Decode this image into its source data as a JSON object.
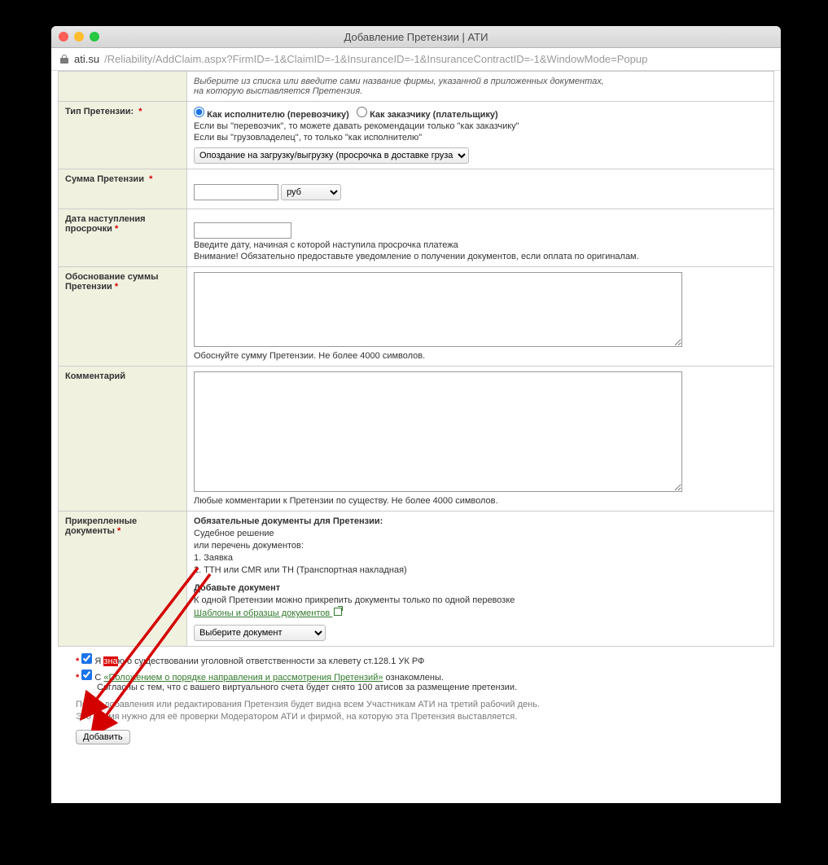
{
  "window": {
    "title": "Добавление Претензии | АТИ",
    "url_host": "ati.su",
    "url_path": "/Reliability/AddClaim.aspx?FirmID=-1&ClaimID=-1&InsuranceID=-1&InsuranceContractID=-1&WindowMode=Popup"
  },
  "rows": {
    "firm_hint1": "Выберите из списка или введите сами название фирмы, указанной в приложенных документах,",
    "firm_hint2": "на которую выставляется Претензия.",
    "type": {
      "label": "Тип Претензии:",
      "radio1": "Как исполнителю (перевозчику)",
      "radio2": "Как заказчику (плательщику)",
      "hint1": "Если вы \"перевозчик\", то можете давать рекомендации только \"как заказчику\"",
      "hint2": "Если вы \"грузовладелец\", то только \"как исполнителю\"",
      "select_value": "Опоздание на загрузку/выгрузку (просрочка в доставке груза)"
    },
    "sum": {
      "label": "Сумма Претензии",
      "currency": "руб"
    },
    "date": {
      "label": "Дата наступления просрочки",
      "hint1": "Введите дату, начиная с которой наступила просрочка платежа",
      "hint2": "Внимание! Обязательно предоставьте уведомление о получении документов, если оплата по оригиналам."
    },
    "reason": {
      "label": "Обоснование суммы Претензии",
      "hint": "Обоснуйте сумму Претензии. Не более 4000 символов."
    },
    "comment": {
      "label": "Комментарий",
      "hint": "Любые комментарии к Претензии по существу. Не более 4000 символов."
    },
    "docs": {
      "label": "Прикрепленные документы",
      "head1": "Обязательные документы для Претензии:",
      "line1": "Судебное решение",
      "line2": "или перечень документов:",
      "line3": "1. Заявка",
      "line4": "2. ТТН или CMR или ТН (Транспортная накладная)",
      "head2": "Добавьте документ",
      "line5": "К одной Претензии можно прикрепить документы только по одной перевозке",
      "templates_link": "Шаблоны и образцы документов ",
      "select_value": "Выберите документ"
    }
  },
  "bottom": {
    "cb1_prefix": "Я ",
    "cb1_text_suffix": "ю о существовании уголовной ответственности за клевету ст.128.1 УК РФ",
    "cb2_prefix": "С ",
    "cb2_link": "«Положением о порядке направления и рассмотрения Претензий»",
    "cb2_suffix": " ознакомлены.",
    "cb2_line2": "Согласны с тем, что с вашего виртуального счета будет снято 100 атисов за размещение претензии.",
    "note1": "После добавления или редактирования Претензия будет видна всем Участникам АТИ на третий рабочий день.",
    "note2": "Это время нужно для её проверки Модератором АТИ и фирмой, на которую эта Претензия выставляется.",
    "add_btn": "Добавить"
  }
}
